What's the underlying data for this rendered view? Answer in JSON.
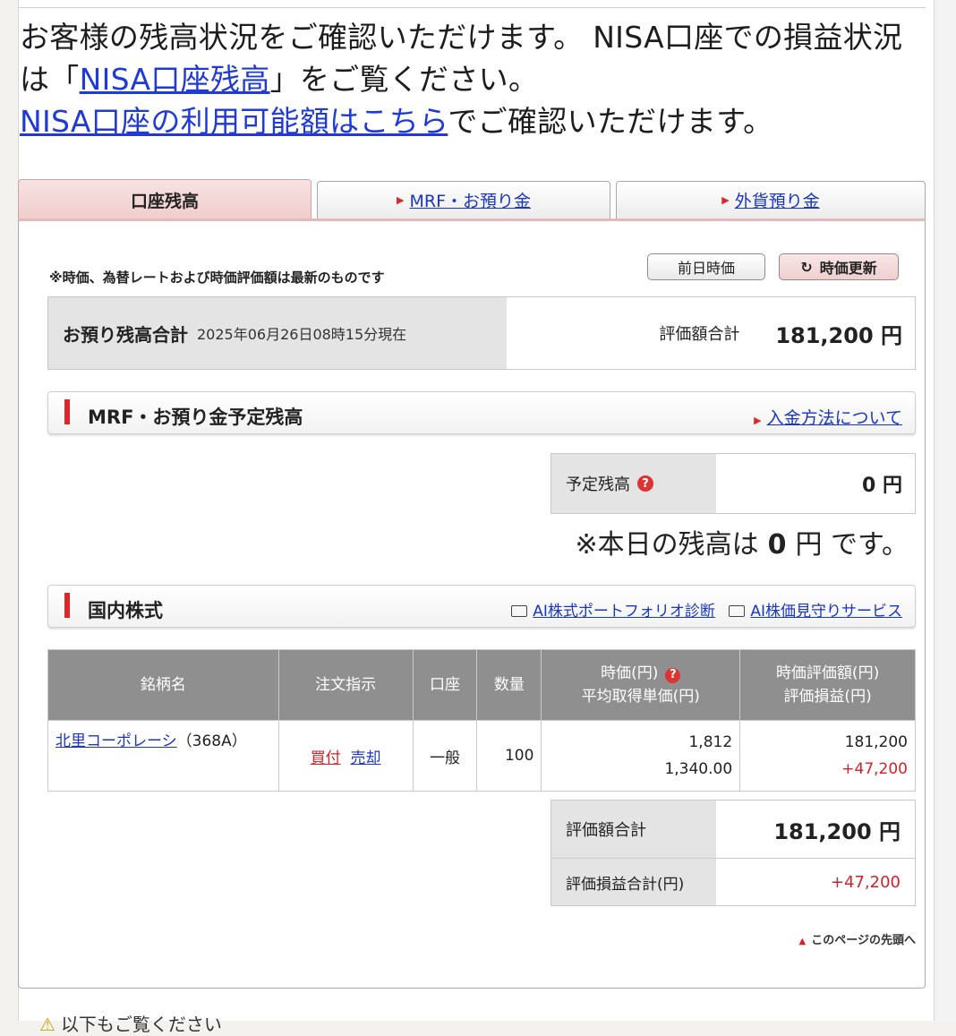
{
  "intro": {
    "line1_a": "お客様の残高状況をご確認いただけます。 NISA口座での損益状況は「",
    "nisa_balance_link": "NISA口座残高",
    "line1_b": "」をご覧ください。",
    "nisa_limit_link": "NISA口座の利用可能額はこちら",
    "line2_b": "でご確認いただけます。"
  },
  "tabs": [
    {
      "label": "口座残高"
    },
    {
      "label": "MRF・お預り金"
    },
    {
      "label": "外貨預り金"
    }
  ],
  "panel": {
    "note": "※時価、為替レートおよび時価評価額は最新のものです",
    "prev_price_button": "前日時価",
    "update_button": "時価更新",
    "update_icon": "↻"
  },
  "summary": {
    "label": "お預り残高合計",
    "timestamp": "2025年06月26日08時15分現在",
    "eval_label": "評価額合計",
    "eval_value": "181,200 円"
  },
  "mrf": {
    "title": "MRF・お預り金予定残高",
    "deposit_link": "入金方法について",
    "scheduled_label": "予定残高",
    "scheduled_value": "0 円",
    "today_prefix": "※本日の残高は",
    "today_value": "0",
    "today_suffix": "円 です。"
  },
  "domestic": {
    "title": "国内株式",
    "ai_portfolio_link": "AI株式ポートフォリオ診断",
    "ai_watch_link": "AI株価見守りサービス",
    "headers": {
      "name": "銘柄名",
      "order": "注文指示",
      "account": "口座",
      "qty": "数量",
      "price": "時価(円)",
      "avg": "平均取得単価(円)",
      "eval": "時価評価額(円)",
      "pl": "評価損益(円)"
    },
    "rows": [
      {
        "name": "北里コーポレーシ",
        "code": "（368A）",
        "buy": "買付",
        "sell": "売却",
        "account": "一般",
        "qty": "100",
        "price": "1,812",
        "avg": "1,340.00",
        "eval": "181,200",
        "pl": "+47,200"
      }
    ]
  },
  "totals": {
    "eval_label": "評価額合計",
    "eval_value": "181,200 円",
    "pl_label": "評価損益合計(円)",
    "pl_value": "+47,200"
  },
  "page_top_link": "このページの先頭へ",
  "bottom_text": "以下もご覧ください",
  "colors": {
    "accent_red": "#d6202a",
    "link_blue": "#1a36c8",
    "header_gray": "#8f8f8f"
  }
}
